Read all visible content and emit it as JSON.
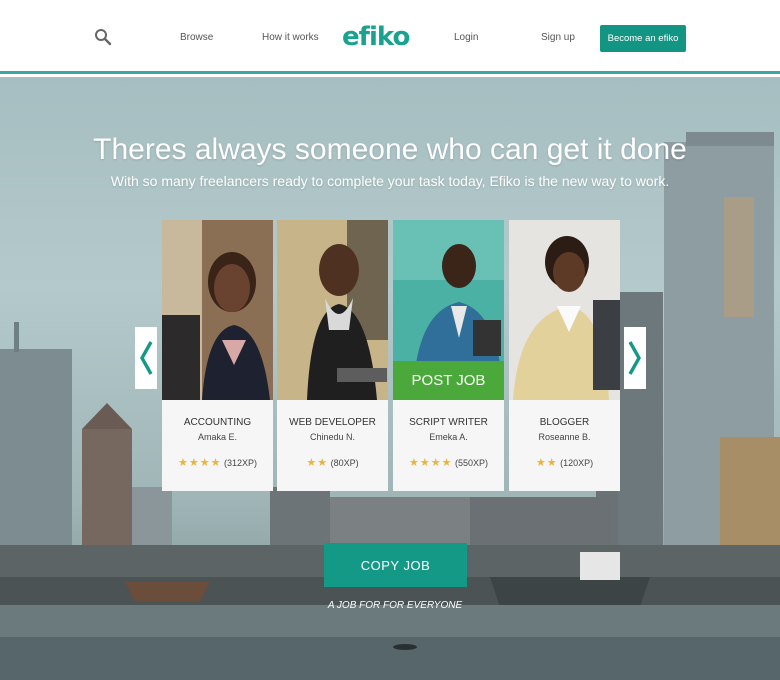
{
  "nav": {
    "browse": "Browse",
    "how_it_works": "How it works",
    "logo_text": "efiko",
    "login": "Login",
    "signup": "Sign up",
    "cta": "Become an efiko"
  },
  "hero": {
    "headline": "Theres always someone who can get it done",
    "subhead": "With so many freelancers ready to complete your task today, Efiko is the new way to work.",
    "cards": [
      {
        "title": "ACCOUNTING",
        "person": "Amaka E.",
        "stars": "★★★★",
        "xp": "(312XP)"
      },
      {
        "title": "WEB DEVELOPER",
        "person": "Chinedu N.",
        "stars": "★★",
        "xp": "(80XP)"
      },
      {
        "title": "SCRIPT WRITER",
        "person": "Emeka A.",
        "stars": "★★★★",
        "xp": "(550XP)",
        "overlay": "POST JOB"
      },
      {
        "title": "BLOGGER",
        "person": "Roseanne B.",
        "stars": "★★",
        "xp": "(120XP)"
      }
    ],
    "copy_job": "COPY JOB",
    "tagline": "A JOB FOR FOR EVERYONE"
  },
  "colors": {
    "brand": "#17a38f",
    "post_job": "#4aa93a",
    "star": "#e8b53f"
  }
}
